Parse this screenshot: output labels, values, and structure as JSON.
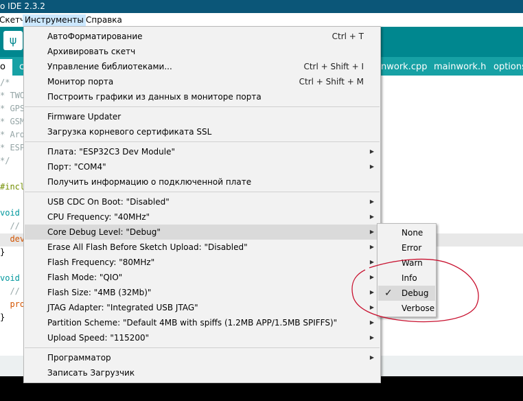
{
  "window": {
    "title": "o IDE 2.3.2"
  },
  "menubar": {
    "items": [
      "Скетч",
      "Инструменты",
      "Справка"
    ]
  },
  "toolbar": {
    "upload_icon": "usb-icon",
    "glyph": "ψ"
  },
  "tabs": [
    "o",
    "c",
    "nwork.cpp",
    "mainwork.h",
    "options"
  ],
  "editor": {
    "lines": [
      {
        "text": "/*",
        "color": "#95a5a6"
      },
      {
        "text": "* TWO",
        "color": "#95a5a6"
      },
      {
        "text": "* GPS",
        "color": "#95a5a6"
      },
      {
        "text": "* GSM",
        "color": "#95a5a6"
      },
      {
        "text": "* Ard",
        "color": "#95a5a6"
      },
      {
        "text": "* ESP",
        "color": "#95a5a6"
      },
      {
        "text": "*/",
        "color": "#95a5a6"
      },
      {
        "text": "",
        "color": "#000000"
      },
      {
        "text": "#incl",
        "color": "#728e00"
      },
      {
        "text": "",
        "color": "#000000"
      },
      {
        "text": "void",
        "color": "#00979d"
      },
      {
        "text": "  //",
        "color": "#95a5a6"
      },
      {
        "text": "  dev",
        "color": "#d35400"
      },
      {
        "text": "}",
        "color": "#000000"
      },
      {
        "text": "",
        "color": "#000000"
      },
      {
        "text": "void",
        "color": "#00979d"
      },
      {
        "text": "  //",
        "color": "#95a5a6"
      },
      {
        "text": "  pro",
        "color": "#d35400"
      },
      {
        "text": "}",
        "color": "#000000"
      }
    ]
  },
  "tools_menu": {
    "groups": [
      [
        {
          "label": "АвтоФорматирование",
          "shortcut": "Ctrl + T"
        },
        {
          "label": "Архивировать скетч"
        },
        {
          "label": "Управление библиотеками...",
          "shortcut": "Ctrl + Shift + I"
        },
        {
          "label": "Монитор порта",
          "shortcut": "Ctrl + Shift + M"
        },
        {
          "label": "Построить графики из данных в мониторе порта"
        }
      ],
      [
        {
          "label": "Firmware Updater"
        },
        {
          "label": "Загрузка корневого сертификата SSL"
        }
      ],
      [
        {
          "label": "Плата: \"ESP32C3 Dev Module\"",
          "submenu": true
        },
        {
          "label": "Порт: \"COM4\"",
          "submenu": true
        },
        {
          "label": "Получить информацию о подключенной плате"
        }
      ],
      [
        {
          "label": "USB CDC On Boot: \"Disabled\"",
          "submenu": true
        },
        {
          "label": "CPU Frequency: \"40MHz\"",
          "submenu": true
        },
        {
          "label": "Core Debug Level: \"Debug\"",
          "submenu": true,
          "selected": true
        },
        {
          "label": "Erase All Flash Before Sketch Upload: \"Disabled\"",
          "submenu": true
        },
        {
          "label": "Flash Frequency: \"80MHz\"",
          "submenu": true
        },
        {
          "label": "Flash Mode: \"QIO\"",
          "submenu": true
        },
        {
          "label": "Flash Size: \"4MB (32Mb)\"",
          "submenu": true
        },
        {
          "label": "JTAG Adapter: \"Integrated USB JTAG\"",
          "submenu": true
        },
        {
          "label": "Partition Scheme: \"Default 4MB with spiffs (1.2MB APP/1.5MB SPIFFS)\"",
          "submenu": true
        },
        {
          "label": "Upload Speed: \"115200\"",
          "submenu": true
        }
      ],
      [
        {
          "label": "Программатор",
          "submenu": true
        },
        {
          "label": "Записать Загрузчик"
        }
      ]
    ]
  },
  "debug_submenu": {
    "items": [
      {
        "label": "None"
      },
      {
        "label": "Error"
      },
      {
        "label": "Warn"
      },
      {
        "label": "Info"
      },
      {
        "label": "Debug",
        "checked": true
      },
      {
        "label": "Verbose"
      }
    ],
    "check_glyph": "✓"
  },
  "colors": {
    "accent": "#00878f",
    "title_bar": "#0b5678",
    "annotation": "#c8102e"
  }
}
